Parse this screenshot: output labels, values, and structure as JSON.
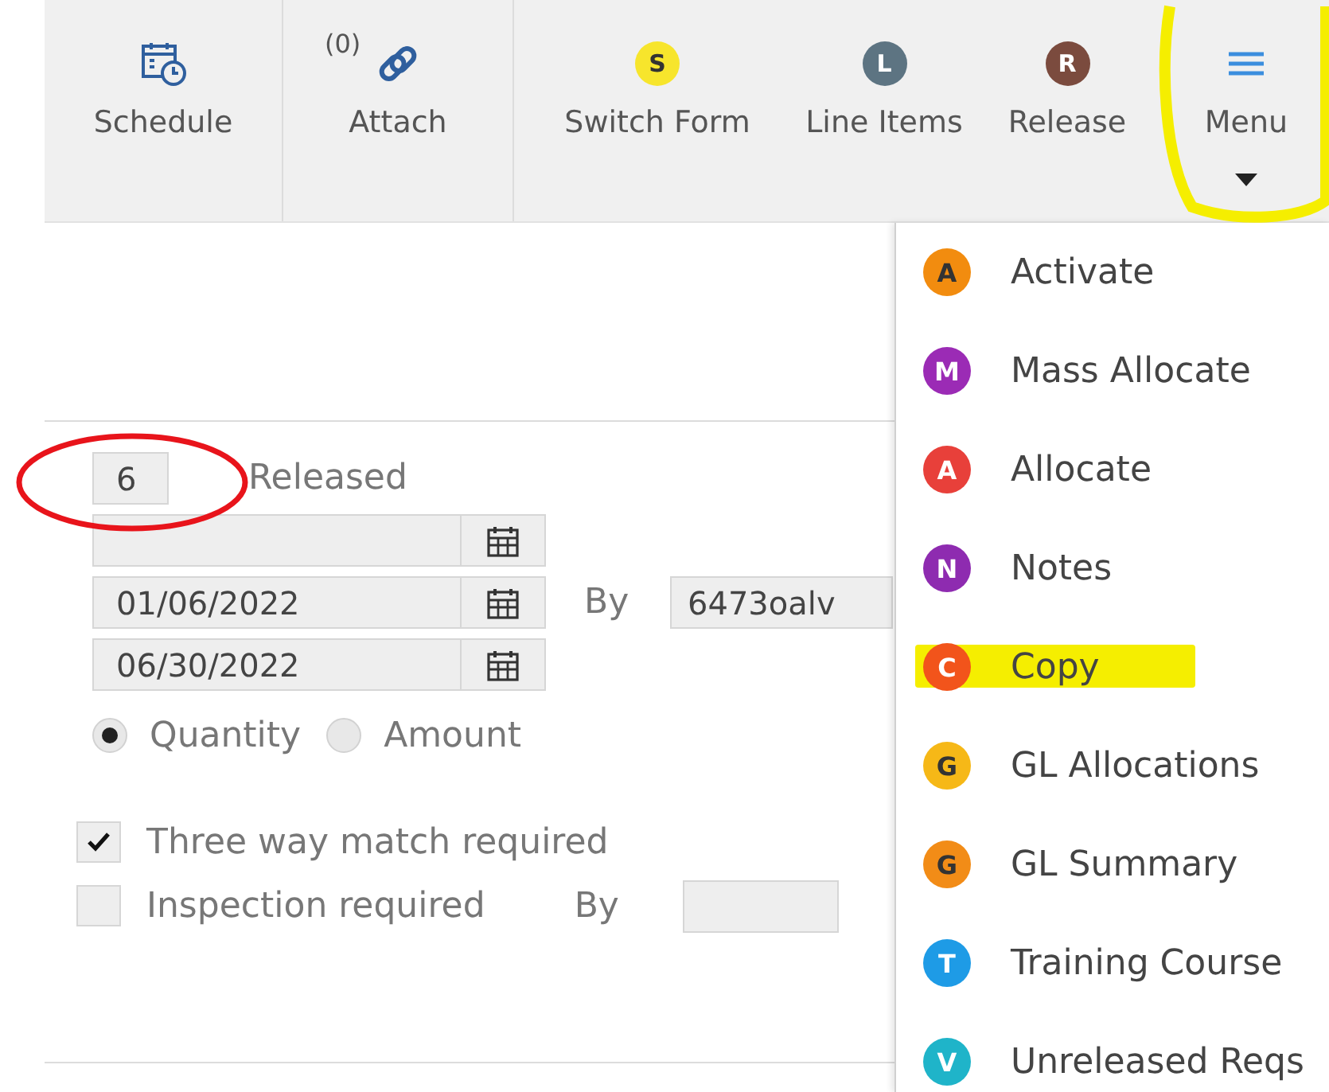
{
  "toolbar": {
    "items": [
      {
        "kind": "calendar",
        "label": "Schedule"
      },
      {
        "kind": "attach",
        "label": "Attach",
        "count": "(0)"
      },
      {
        "kind": "badge",
        "label": "Switch Form",
        "letter": "S",
        "color": "#f7e52c"
      },
      {
        "kind": "badge",
        "label": "Line Items",
        "letter": "L",
        "color": "#5d7482"
      },
      {
        "kind": "badge",
        "label": "Release",
        "letter": "R",
        "color": "#7b4b3e"
      },
      {
        "kind": "menu",
        "label": "Menu",
        "expanded": true
      }
    ]
  },
  "form": {
    "released": {
      "value": "6",
      "label": "Released"
    },
    "dates": [
      {
        "kind": "date"
      },
      {
        "kind": "date",
        "value": "01/06/2022",
        "by_label": "By",
        "by_value": "6473oalv"
      },
      {
        "kind": "date",
        "value": "06/30/2022"
      }
    ],
    "basis": [
      {
        "label": "Quantity",
        "selected": true
      },
      {
        "label": "Amount",
        "selected": false
      }
    ],
    "checks": [
      {
        "label": "Three way match required",
        "checked": true
      },
      {
        "label": "Inspection required",
        "checked": false,
        "by_label": "By"
      }
    ]
  },
  "menu": {
    "items": [
      {
        "letter": "A",
        "label": "Activate",
        "color": "#f28c0f"
      },
      {
        "letter": "M",
        "label": "Mass Allocate",
        "color": "#9b2bb5"
      },
      {
        "letter": "A",
        "label": "Allocate",
        "color": "#e8403a"
      },
      {
        "letter": "N",
        "label": "Notes",
        "color": "#8e2bb0"
      },
      {
        "letter": "C",
        "label": "Copy",
        "color": "#f2541b"
      },
      {
        "letter": "G",
        "label": "GL Allocations",
        "color": "#f6b817"
      },
      {
        "letter": "G",
        "label": "GL Summary",
        "color": "#f28c17"
      },
      {
        "letter": "T",
        "label": "Training Course",
        "color": "#1e9be6"
      },
      {
        "letter": "V",
        "label": "Unreleased Reqs",
        "color": "#1fb4c9"
      }
    ]
  },
  "annotations": [
    {
      "kind": "circle"
    },
    {
      "kind": "glow"
    },
    {
      "kind": "marker"
    }
  ]
}
